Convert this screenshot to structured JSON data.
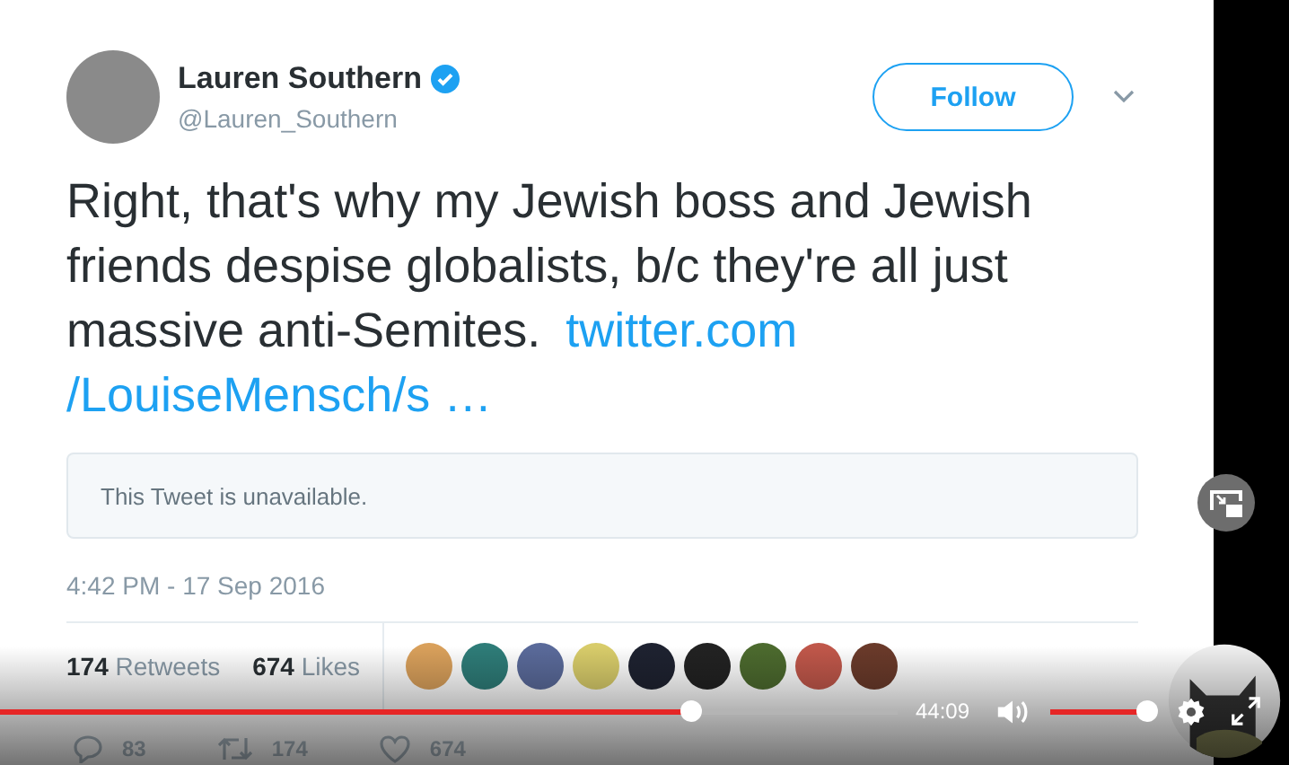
{
  "tweet": {
    "author": "Lauren Southern",
    "handle": "@Lauren_Southern",
    "verified": true,
    "follow_button": "Follow",
    "lines": [
      {
        "parts": [
          {
            "kind": "text",
            "text": "Right, that's why my Jewish boss and Jewish"
          }
        ]
      },
      {
        "parts": [
          {
            "kind": "text",
            "text": "friends despise globalists, b/c they're all just"
          }
        ]
      },
      {
        "parts": [
          {
            "kind": "text",
            "text": "massive anti-Semites."
          },
          {
            "kind": "link",
            "text": "twitter.com"
          }
        ]
      },
      {
        "parts": [
          {
            "kind": "link",
            "text": "/LouiseMensch/s …"
          }
        ]
      }
    ],
    "quoted": "This Tweet is unavailable.",
    "timestamp": "4:42 PM - 17 Sep 2016",
    "stats": [
      {
        "count": "174",
        "label": "Retweets"
      },
      {
        "count": "674",
        "label": "Likes"
      }
    ],
    "likers": [
      {
        "color": "#d9a05b"
      },
      {
        "color": "#2e7c78"
      },
      {
        "color": "#5a6a9a"
      },
      {
        "color": "#d8cc6a"
      },
      {
        "color": "#1e2230"
      },
      {
        "color": "#222222"
      },
      {
        "color": "#4c6a2e"
      },
      {
        "color": "#c0574a"
      },
      {
        "color": "#6a3a2a"
      }
    ],
    "actions": [
      {
        "kind": "reply",
        "count": "83"
      },
      {
        "kind": "retweet",
        "count": "174"
      },
      {
        "kind": "like",
        "count": "674"
      }
    ]
  },
  "player": {
    "progress": {
      "level": 0.77
    },
    "time": "44:09",
    "volume": {
      "level": 1
    }
  }
}
